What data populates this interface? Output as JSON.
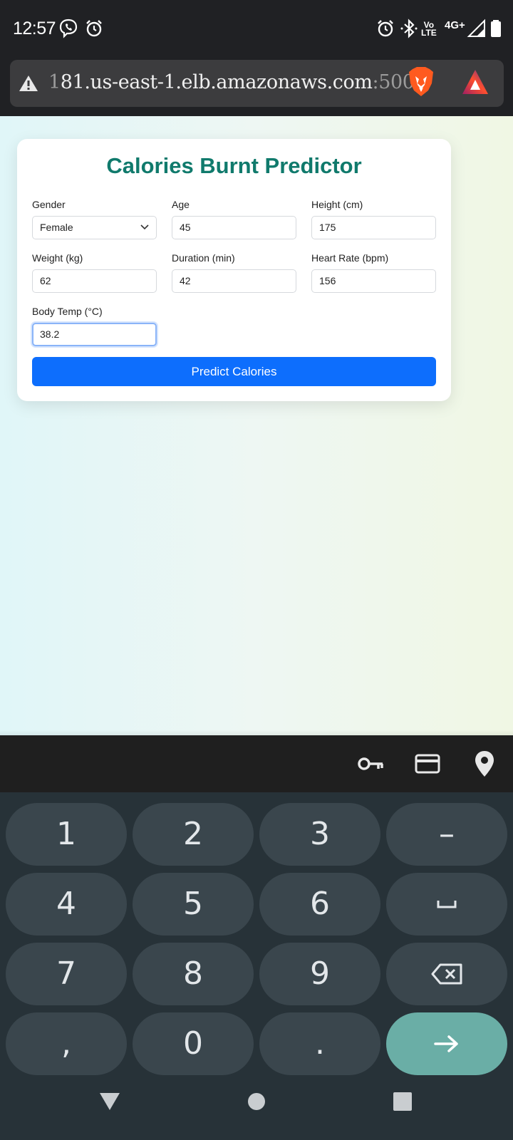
{
  "status_bar": {
    "time": "12:57",
    "left_icons": [
      "viber-icon",
      "alarm-icon"
    ],
    "right_icons": [
      "alarm-icon",
      "bluetooth-icon",
      "volte-icon",
      "4g-icon",
      "signal-icon",
      "battery-icon"
    ],
    "volte_top": "Vo",
    "volte_bottom": "LTE",
    "network": "4G+"
  },
  "browser": {
    "url_prefix": "1",
    "url_host": "81.us-east-1.elb.amazonaws.com",
    "url_port": ":5000",
    "warning_icon": "warning-icon",
    "brave_icon": "brave-lion-icon",
    "rewards_icon": "brave-rewards-icon"
  },
  "form": {
    "title": "Calories Burnt Predictor",
    "gender": {
      "label": "Gender",
      "value": "Female"
    },
    "age": {
      "label": "Age",
      "value": "45"
    },
    "height": {
      "label": "Height (cm)",
      "value": "175"
    },
    "weight": {
      "label": "Weight (kg)",
      "value": "62"
    },
    "duration": {
      "label": "Duration (min)",
      "value": "42"
    },
    "heart_rate": {
      "label": "Heart Rate (bpm)",
      "value": "156"
    },
    "body_temp": {
      "label": "Body Temp (°C)",
      "value": "38.2"
    },
    "submit_label": "Predict Calories",
    "accent_color": "#107a6c",
    "button_color": "#0d6efd"
  },
  "autofill": {
    "icons": [
      "key-icon",
      "credit-card-icon",
      "location-pin-icon"
    ]
  },
  "keyboard": {
    "rows": [
      [
        "1",
        "2",
        "3",
        "–"
      ],
      [
        "4",
        "5",
        "6",
        "␣"
      ],
      [
        "7",
        "8",
        "9",
        "backspace"
      ],
      [
        ",",
        "0",
        ".",
        "→"
      ]
    ],
    "enter_color": "#6aaea6"
  },
  "nav_bar": {
    "icons": [
      "back-triangle-icon",
      "home-circle-icon",
      "recents-square-icon"
    ]
  }
}
